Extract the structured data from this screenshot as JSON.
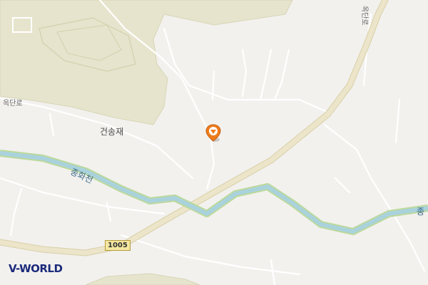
{
  "map": {
    "provider": "V-WORLD",
    "places": {
      "village": "건송재"
    },
    "roads": {
      "left_road": "옥단로",
      "right_road": "옥단로",
      "route_number": "1005"
    },
    "rivers": {
      "left_label": "종화천",
      "right_label": "종"
    },
    "colors": {
      "background": "#f2f1ee",
      "forest": "#e6e4cc",
      "river": "#a9d2dc",
      "river_bank": "#b9d99a",
      "main_road": "#e9e2c8",
      "minor_road": "#ffffff",
      "marker": "#ef7c1c"
    },
    "icons": {
      "marker": "location-pin-icon"
    }
  }
}
